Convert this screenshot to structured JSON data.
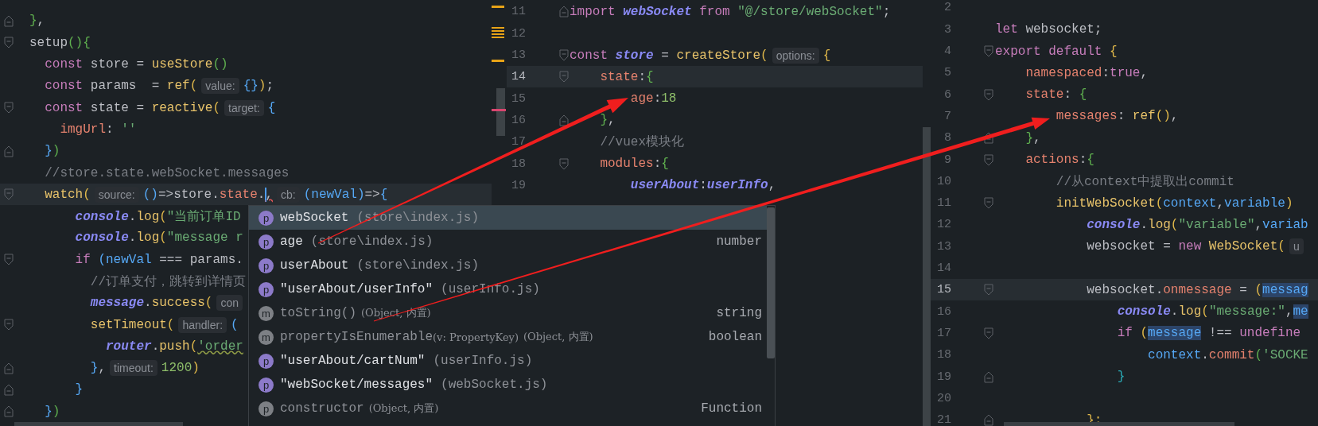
{
  "editors": [
    {
      "lines": [
        {
          "current": false,
          "fold": {
            "kind": "end"
          },
          "tokens": [
            {
              "t": "}",
              "kind": "bg"
            },
            {
              "t": ",",
              "kind": "pl"
            }
          ]
        },
        {
          "current": false,
          "fold": {
            "kind": "start"
          },
          "tokens": [
            {
              "t": "setup",
              "kind": "pl"
            },
            {
              "t": "()",
              "kind": "bg"
            },
            {
              "t": "{",
              "kind": "bg"
            }
          ]
        },
        {
          "current": false,
          "tokens": [
            {
              "t": "  const",
              "kind": "kw"
            },
            {
              "t": " store = ",
              "kind": "pl"
            },
            {
              "t": "useStore",
              "kind": "fn"
            },
            {
              "t": "()",
              "kind": "bg"
            }
          ]
        },
        {
          "current": false,
          "tokens": [
            {
              "t": "  const",
              "kind": "kw"
            },
            {
              "t": " params  = ",
              "kind": "pl"
            },
            {
              "t": "ref",
              "kind": "fn"
            },
            {
              "t": "(",
              "kind": "by"
            },
            {
              "t": "value:",
              "kind": "hint"
            },
            {
              "t": "{}",
              "kind": "bb"
            },
            {
              "t": ")",
              "kind": "by"
            },
            {
              "t": ";",
              "kind": "pl"
            }
          ]
        },
        {
          "current": false,
          "fold": {
            "kind": "start"
          },
          "tokens": [
            {
              "t": "  const",
              "kind": "kw"
            },
            {
              "t": " state = ",
              "kind": "pl"
            },
            {
              "t": "reactive",
              "kind": "fn"
            },
            {
              "t": "(",
              "kind": "by"
            },
            {
              "t": "target:",
              "kind": "hint"
            },
            {
              "t": "{",
              "kind": "bb"
            }
          ]
        },
        {
          "current": false,
          "tokens": [
            {
              "t": "    imgUrl",
              "kind": "pr"
            },
            {
              "t": ": ",
              "kind": "pl"
            },
            {
              "t": "''",
              "kind": "str"
            }
          ]
        },
        {
          "current": false,
          "fold": {
            "kind": "end"
          },
          "tokens": [
            {
              "t": "  }",
              "kind": "bb"
            },
            {
              "t": ")",
              "kind": "bg"
            }
          ]
        },
        {
          "current": false,
          "tokens": [
            {
              "t": "  //store.state.webSocket.messages",
              "kind": "cm"
            }
          ]
        },
        {
          "current": true,
          "fold": {
            "kind": "start"
          },
          "tokens": [
            {
              "t": "  watch",
              "kind": "fn"
            },
            {
              "t": "(",
              "kind": "by"
            },
            {
              "t": "source:",
              "kind": "hint"
            },
            {
              "t": "()",
              "kind": "bb"
            },
            {
              "t": "=>store.",
              "kind": "pl"
            },
            {
              "t": "state",
              "kind": "pr"
            },
            {
              "t": ".",
              "kind": "pl"
            },
            {
              "t": ",",
              "kind": "err",
              "caret": true
            },
            {
              "t": "cb:",
              "kind": "hint"
            },
            {
              "t": "(",
              "kind": "bb"
            },
            {
              "t": "newVal",
              "kind": "pa"
            },
            {
              "t": ")",
              "kind": "bb"
            },
            {
              "t": "=>",
              "kind": "pl"
            },
            {
              "t": "{",
              "kind": "bb"
            }
          ]
        },
        {
          "current": false,
          "tokens": [
            {
              "t": "      console",
              "kind": "gl"
            },
            {
              "t": ".",
              "kind": "pl"
            },
            {
              "t": "log",
              "kind": "fn"
            },
            {
              "t": "(",
              "kind": "by"
            },
            {
              "t": "\"当前订单ID",
              "kind": "str"
            }
          ]
        },
        {
          "current": false,
          "tokens": [
            {
              "t": "      console",
              "kind": "gl"
            },
            {
              "t": ".",
              "kind": "pl"
            },
            {
              "t": "log",
              "kind": "fn"
            },
            {
              "t": "(",
              "kind": "by"
            },
            {
              "t": "\"message r",
              "kind": "str"
            }
          ]
        },
        {
          "current": false,
          "fold": {
            "kind": "start"
          },
          "tokens": [
            {
              "t": "      if",
              "kind": "kw"
            },
            {
              "t": " (",
              "kind": "bb"
            },
            {
              "t": "newVal",
              "kind": "pa"
            },
            {
              "t": " === params.",
              "kind": "pl"
            }
          ]
        },
        {
          "current": false,
          "tokens": [
            {
              "t": "        //订单支付，跳转到详情页",
              "kind": "cm"
            }
          ]
        },
        {
          "current": false,
          "tokens": [
            {
              "t": "        message",
              "kind": "gl"
            },
            {
              "t": ".",
              "kind": "pl"
            },
            {
              "t": "success",
              "kind": "fn"
            },
            {
              "t": "(",
              "kind": "by"
            },
            {
              "t": "con",
              "kind": "hint"
            }
          ]
        },
        {
          "current": false,
          "fold": {
            "kind": "start"
          },
          "tokens": [
            {
              "t": "        setTimeout",
              "kind": "fn"
            },
            {
              "t": "(",
              "kind": "by"
            },
            {
              "t": "handler:",
              "kind": "hint"
            },
            {
              "t": "(",
              "kind": "bb"
            }
          ]
        },
        {
          "current": false,
          "tokens": [
            {
              "t": "          router",
              "kind": "gl"
            },
            {
              "t": ".",
              "kind": "pl"
            },
            {
              "t": "push",
              "kind": "fn"
            },
            {
              "t": "(",
              "kind": "by"
            },
            {
              "t": "'order",
              "kind": "warn"
            }
          ]
        },
        {
          "current": false,
          "fold": {
            "kind": "end"
          },
          "tokens": [
            {
              "t": "        }",
              "kind": "bb"
            },
            {
              "t": ",",
              "kind": "pl"
            },
            {
              "t": "timeout:",
              "kind": "hint"
            },
            {
              "t": "1200",
              "kind": "num"
            },
            {
              "t": ")",
              "kind": "by"
            }
          ]
        },
        {
          "current": false,
          "fold": {
            "kind": "end"
          },
          "tokens": [
            {
              "t": "      }",
              "kind": "bb"
            }
          ]
        },
        {
          "current": false,
          "fold": {
            "kind": "end"
          },
          "tokens": [
            {
              "t": "  }",
              "kind": "bb"
            },
            {
              "t": ")",
              "kind": "bg"
            }
          ]
        }
      ]
    },
    {
      "lines": [
        {
          "n": "11",
          "current": false,
          "fold": {
            "kind": "end"
          },
          "tokens": [
            {
              "t": "import",
              "kind": "kw"
            },
            {
              "t": " webSocket",
              "kind": "gl"
            },
            {
              "t": " from",
              "kind": "kw"
            },
            {
              "t": " \"@/store/webSocket\"",
              "kind": "str"
            },
            {
              "t": ";",
              "kind": "pl"
            }
          ]
        },
        {
          "n": "12",
          "current": false
        },
        {
          "n": "13",
          "current": false,
          "fold": {
            "kind": "start"
          },
          "tokens": [
            {
              "t": "const",
              "kind": "kw"
            },
            {
              "t": " store",
              "kind": "gl"
            },
            {
              "t": " = ",
              "kind": "pl"
            },
            {
              "t": "createStore",
              "kind": "fn"
            },
            {
              "t": "(",
              "kind": "by"
            },
            {
              "t": "options:",
              "kind": "hint"
            },
            {
              "t": "{",
              "kind": "by"
            }
          ]
        },
        {
          "n": "14",
          "current": true,
          "fold": {
            "kind": "start"
          },
          "tokens": [
            {
              "t": "    state",
              "kind": "pr"
            },
            {
              "t": ":",
              "kind": "pl"
            },
            {
              "t": "{",
              "kind": "bg"
            }
          ]
        },
        {
          "n": "15",
          "current": false,
          "tokens": [
            {
              "t": "        age",
              "kind": "pr"
            },
            {
              "t": ":",
              "kind": "pl"
            },
            {
              "t": "18",
              "kind": "num"
            }
          ]
        },
        {
          "n": "16",
          "current": false,
          "fold": {
            "kind": "end"
          },
          "tokens": [
            {
              "t": "    }",
              "kind": "bg"
            },
            {
              "t": ",",
              "kind": "pl"
            }
          ]
        },
        {
          "n": "17",
          "current": false,
          "tokens": [
            {
              "t": "    //vuex模块化",
              "kind": "cm"
            }
          ]
        },
        {
          "n": "18",
          "current": false,
          "fold": {
            "kind": "start"
          },
          "tokens": [
            {
              "t": "    modules",
              "kind": "pr"
            },
            {
              "t": ":",
              "kind": "pl"
            },
            {
              "t": "{",
              "kind": "bg"
            }
          ]
        },
        {
          "n": "19",
          "current": false,
          "tokens": [
            {
              "t": "        userAbout",
              "kind": "gl"
            },
            {
              "t": ":",
              "kind": "pl"
            },
            {
              "t": "userInfo",
              "kind": "gl"
            },
            {
              "t": ",",
              "kind": "pl"
            }
          ]
        }
      ]
    },
    {
      "lines": [
        {
          "n": "2",
          "current": false
        },
        {
          "n": "3",
          "current": false,
          "tokens": [
            {
              "t": "let",
              "kind": "kw"
            },
            {
              "t": " websocket;",
              "kind": "pl"
            }
          ]
        },
        {
          "n": "4",
          "current": false,
          "fold": {
            "kind": "start"
          },
          "tokens": [
            {
              "t": "export default",
              "kind": "kw"
            },
            {
              "t": " {",
              "kind": "by"
            }
          ]
        },
        {
          "n": "5",
          "current": false,
          "tokens": [
            {
              "t": "    namespaced",
              "kind": "pr"
            },
            {
              "t": ":",
              "kind": "pl"
            },
            {
              "t": "true",
              "kind": "kw"
            },
            {
              "t": ",",
              "kind": "pl"
            }
          ]
        },
        {
          "n": "6",
          "current": false,
          "fold": {
            "kind": "start"
          },
          "tokens": [
            {
              "t": "    state",
              "kind": "pr"
            },
            {
              "t": ": ",
              "kind": "pl"
            },
            {
              "t": "{",
              "kind": "bg"
            }
          ]
        },
        {
          "n": "7",
          "current": false,
          "tokens": [
            {
              "t": "        messages",
              "kind": "pr"
            },
            {
              "t": ": ",
              "kind": "pl"
            },
            {
              "t": "ref",
              "kind": "fn"
            },
            {
              "t": "()",
              "kind": "by"
            },
            {
              "t": ",",
              "kind": "pl"
            }
          ]
        },
        {
          "n": "8",
          "current": false,
          "fold": {
            "kind": "end"
          },
          "tokens": [
            {
              "t": "    }",
              "kind": "bg"
            },
            {
              "t": ",",
              "kind": "pl"
            }
          ]
        },
        {
          "n": "9",
          "current": false,
          "fold": {
            "kind": "start"
          },
          "tokens": [
            {
              "t": "    actions",
              "kind": "pr"
            },
            {
              "t": ":",
              "kind": "pl"
            },
            {
              "t": "{",
              "kind": "bg"
            }
          ]
        },
        {
          "n": "10",
          "current": false,
          "tokens": [
            {
              "t": "        //从context中提取出commit",
              "kind": "cm"
            }
          ]
        },
        {
          "n": "11",
          "current": false,
          "fold": {
            "kind": "start"
          },
          "tokens": [
            {
              "t": "        initWebSocket",
              "kind": "fn"
            },
            {
              "t": "(",
              "kind": "by"
            },
            {
              "t": "context",
              "kind": "pa"
            },
            {
              "t": ",",
              "kind": "pl"
            },
            {
              "t": "variable",
              "kind": "pa"
            },
            {
              "t": ")",
              "kind": "by"
            }
          ]
        },
        {
          "n": "12",
          "current": false,
          "tokens": [
            {
              "t": "            console",
              "kind": "gl"
            },
            {
              "t": ".",
              "kind": "pl"
            },
            {
              "t": "log",
              "kind": "fn"
            },
            {
              "t": "(",
              "kind": "by"
            },
            {
              "t": "\"variable\"",
              "kind": "str"
            },
            {
              "t": ",",
              "kind": "pl"
            },
            {
              "t": "variab",
              "kind": "pa"
            }
          ]
        },
        {
          "n": "13",
          "current": false,
          "tokens": [
            {
              "t": "            websocket = ",
              "kind": "pl"
            },
            {
              "t": "new",
              "kind": "kw"
            },
            {
              "t": " WebSocket",
              "kind": "fn"
            },
            {
              "t": "(",
              "kind": "by"
            },
            {
              "t": "u",
              "kind": "hint"
            }
          ]
        },
        {
          "n": "14",
          "current": false
        },
        {
          "n": "15",
          "current": true,
          "fold": {
            "kind": "start"
          },
          "tokens": [
            {
              "t": "            websocket",
              "kind": "pl"
            },
            {
              "t": ".",
              "kind": "pl"
            },
            {
              "t": "onmessage",
              "kind": "pr"
            },
            {
              "t": " = ",
              "kind": "pl"
            },
            {
              "t": "(",
              "kind": "by"
            },
            {
              "t": "messag",
              "kind": "sel"
            }
          ]
        },
        {
          "n": "16",
          "current": false,
          "tokens": [
            {
              "t": "                console",
              "kind": "gl"
            },
            {
              "t": ".",
              "kind": "pl"
            },
            {
              "t": "log",
              "kind": "fn"
            },
            {
              "t": "(",
              "kind": "by"
            },
            {
              "t": "\"message:\"",
              "kind": "str"
            },
            {
              "t": ",",
              "kind": "pl"
            },
            {
              "t": "me",
              "kind": "sel"
            }
          ]
        },
        {
          "n": "17",
          "current": false,
          "fold": {
            "kind": "start"
          },
          "tokens": [
            {
              "t": "                if",
              "kind": "kw"
            },
            {
              "t": " (",
              "kind": "by"
            },
            {
              "t": "message",
              "kind": "sel"
            },
            {
              "t": " !== ",
              "kind": "pl"
            },
            {
              "t": "undefine",
              "kind": "kw"
            }
          ]
        },
        {
          "n": "18",
          "current": false,
          "tokens": [
            {
              "t": "                    context",
              "kind": "pa"
            },
            {
              "t": ".",
              "kind": "pl"
            },
            {
              "t": "commit",
              "kind": "pr"
            },
            {
              "t": "(",
              "kind": "bg"
            },
            {
              "t": "'SOCKE",
              "kind": "str"
            }
          ]
        },
        {
          "n": "19",
          "current": false,
          "fold": {
            "kind": "end"
          },
          "tokens": [
            {
              "t": "                }",
              "kind": "bt"
            }
          ]
        },
        {
          "n": "20",
          "current": false
        },
        {
          "n": "21",
          "current": false,
          "fold": {
            "kind": "end"
          },
          "tokens": [
            {
              "t": "            };",
              "kind": "by"
            }
          ]
        }
      ]
    }
  ],
  "completion_popup": {
    "items": [
      {
        "icon": "p",
        "name": "webSocket",
        "detail": "(store\\index.js)",
        "selected": true,
        "inherited": false
      },
      {
        "icon": "p",
        "name": "age",
        "detail": "(store\\index.js)",
        "type": "number",
        "selected": false,
        "inherited": false
      },
      {
        "icon": "p",
        "name": "userAbout",
        "detail": "(store\\index.js)",
        "selected": false,
        "inherited": false
      },
      {
        "icon": "p",
        "name": "\"userAbout/userInfo\"",
        "detail": "(userInfo.js)",
        "selected": false,
        "inherited": false
      },
      {
        "icon": "m",
        "name": "toString()",
        "detail": "(Object, 内置)",
        "type": "string",
        "selected": false,
        "inherited": true
      },
      {
        "icon": "m",
        "name": "propertyIsEnumerable",
        "signature": "(v: PropertyKey)",
        "detail": "(Object, 内置)",
        "type": "boolean",
        "selected": false,
        "inherited": true
      },
      {
        "icon": "p",
        "name": "\"userAbout/cartNum\"",
        "detail": "(userInfo.js)",
        "selected": false,
        "inherited": false
      },
      {
        "icon": "p",
        "name": "\"webSocket/messages\"",
        "detail": "(webSocket.js)",
        "selected": false,
        "inherited": false
      },
      {
        "icon": "p",
        "name": "constructor",
        "detail": "(Object, 内置)",
        "type": "Function",
        "selected": false,
        "inherited": true
      }
    ]
  }
}
